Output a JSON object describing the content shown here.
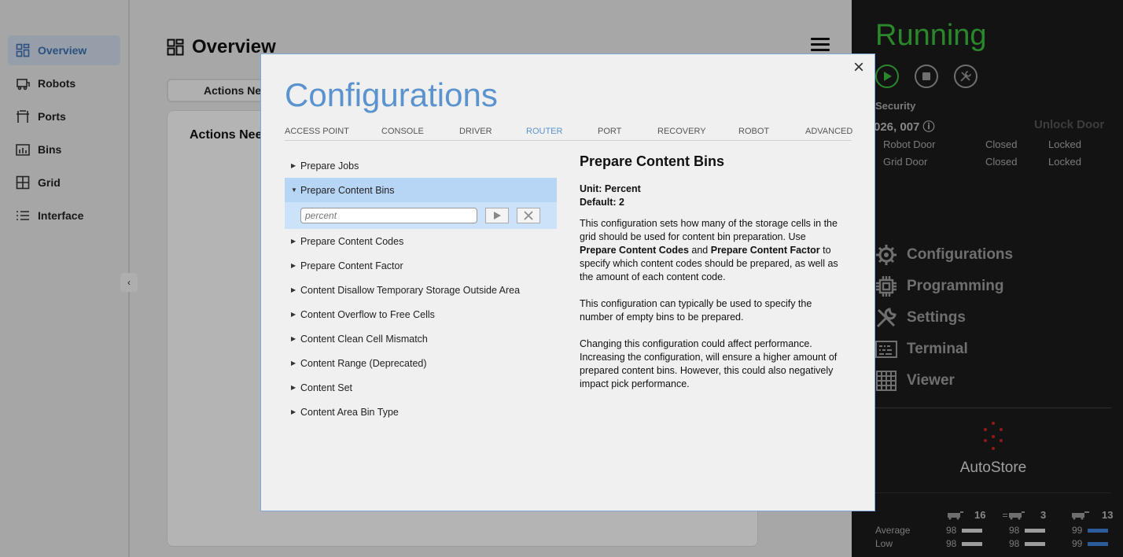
{
  "sidebar": {
    "items": [
      {
        "label": "Overview",
        "icon": "grid-icon"
      },
      {
        "label": "Robots",
        "icon": "robot-icon"
      },
      {
        "label": "Ports",
        "icon": "port-icon"
      },
      {
        "label": "Bins",
        "icon": "bins-icon"
      },
      {
        "label": "Grid",
        "icon": "grid-layout-icon"
      },
      {
        "label": "Interface",
        "icon": "list-icon"
      }
    ],
    "collapse_glyph": "‹"
  },
  "main": {
    "title": "Overview",
    "tab_label": "Actions Nee",
    "card_title": "Actions Nee"
  },
  "right_panel": {
    "status": "Running",
    "security": {
      "label": "Security",
      "codes": "026, 007 ⓘ",
      "unlock_label": "Unlock Door",
      "doors": [
        {
          "name": "Robot Door",
          "state": "Closed",
          "lock": "Locked"
        },
        {
          "name": "Grid Door",
          "state": "Closed",
          "lock": "Locked"
        }
      ]
    },
    "menu": [
      {
        "label": "Configurations",
        "icon": "gear-icon"
      },
      {
        "label": "Programming",
        "icon": "chip-icon"
      },
      {
        "label": "Settings",
        "icon": "wrench-icon"
      },
      {
        "label": "Terminal",
        "icon": "terminal-icon"
      },
      {
        "label": "Viewer",
        "icon": "viewer-icon"
      }
    ],
    "brand": "AutoStore",
    "robot_counts": [
      "16",
      "3",
      "13"
    ],
    "stats": {
      "average_label": "Average",
      "low_label": "Low",
      "average": [
        "98",
        "98",
        "99"
      ],
      "low": [
        "98",
        "98",
        "99"
      ]
    },
    "colors": {
      "status": "#3cbb3c",
      "accent_bar": "#3d7fd6"
    }
  },
  "modal": {
    "title": "Configurations",
    "close_glyph": "×",
    "tabs": [
      "ACCESS POINT",
      "CONSOLE",
      "DRIVER",
      "ROUTER",
      "PORT",
      "RECOVERY",
      "ROBOT",
      "ADVANCED"
    ],
    "active_tab": "ROUTER",
    "items": [
      "Prepare Jobs",
      "Prepare Content Bins",
      "Prepare Content Codes",
      "Prepare Content Factor",
      "Content Disallow Temporary Storage Outside Area",
      "Content Overflow to Free Cells",
      "Content Clean Cell Mismatch",
      "Content Range (Deprecated)",
      "Content Set",
      "Content Area Bin Type"
    ],
    "open_item": "Prepare Content Bins",
    "input_placeholder": "percent",
    "detail": {
      "title": "Prepare Content Bins",
      "unit": "Unit: Percent",
      "default": "Default: 2",
      "p1_a": "This configuration sets how many of the storage cells in the grid should be used for content bin preparation. Use ",
      "p1_b": "Prepare Content Codes",
      "p1_c": " and ",
      "p1_d": "Prepare Content Factor",
      "p1_e": " to specify which content codes should be prepared, as well as the amount of each content code.",
      "p2": "This configuration can typically be used to specify the number of empty bins to be prepared.",
      "p3": "Changing this configuration could affect performance. Increasing the configuration, will ensure a higher amount of prepared content bins. However, this could also negatively impact pick performance."
    },
    "colors": {
      "title": "#5b93cf",
      "selected_row": "#b7d5f4"
    }
  }
}
